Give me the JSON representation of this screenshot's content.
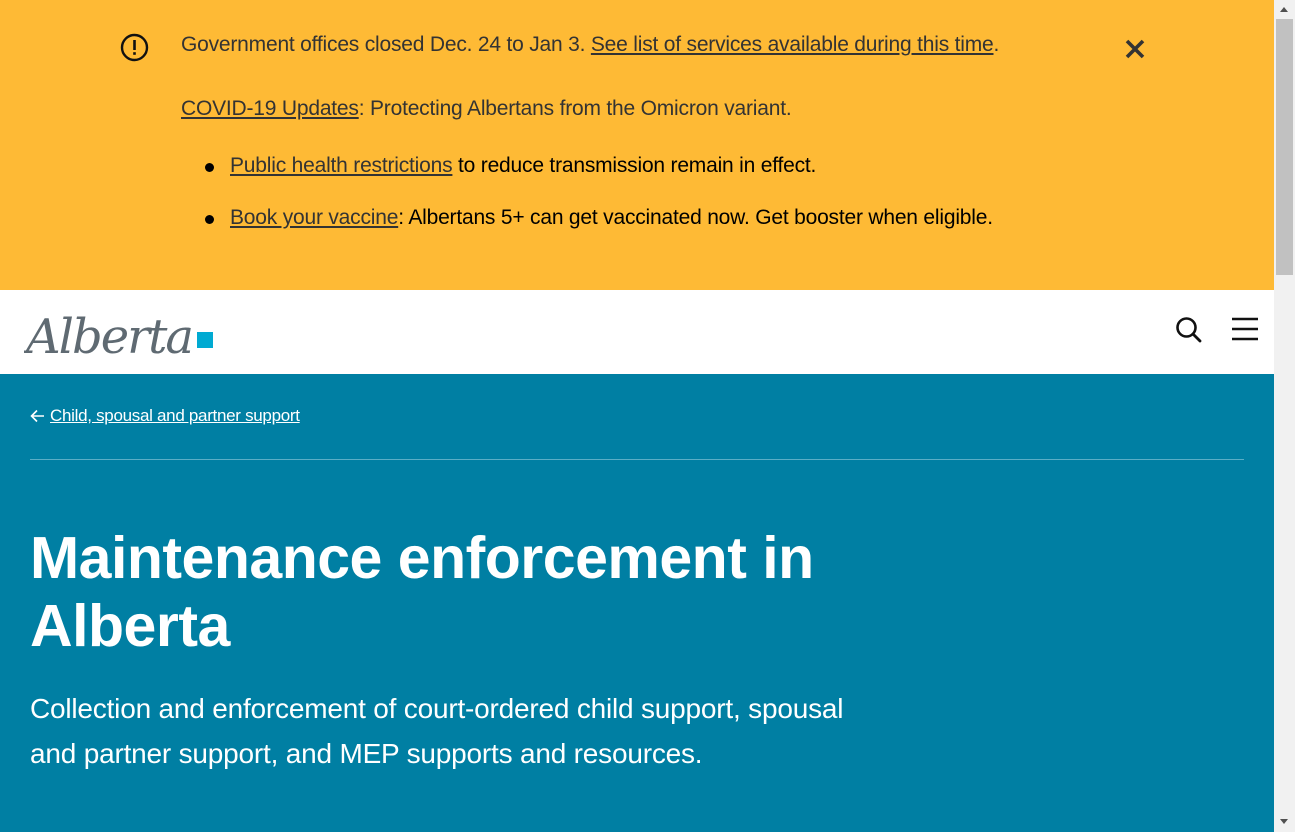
{
  "notice": {
    "line1_text": "Government offices closed Dec. 24 to Jan 3. ",
    "line1_link": "See list of services available during this time",
    "line1_end": ".",
    "line2_link": "COVID-19 Updates",
    "line2_text": ": Protecting Albertans from the Omicron variant.",
    "bullets": [
      {
        "link": "Public health restrictions",
        "text": " to reduce transmission remain in effect."
      },
      {
        "link": "Book your vaccine",
        "text": ": Albertans 5+ can get vaccinated now. Get booster when eligible."
      }
    ],
    "alert_icon": "exclamation-circle-icon",
    "close_icon": "close-x-icon"
  },
  "header": {
    "logo_text": "Alberta",
    "search_icon": "search-icon",
    "menu_icon": "hamburger-menu-icon"
  },
  "hero": {
    "breadcrumb": "Child, spousal and partner support",
    "title": "Maintenance enforcement in Alberta",
    "lead": "Collection and enforcement of court-ordered child support, spousal and partner support, and MEP supports and resources."
  },
  "colors": {
    "banner": "#feba35",
    "hero": "#007fa3",
    "logo_accent": "#00aad2",
    "logo_text": "#5f6a72"
  }
}
